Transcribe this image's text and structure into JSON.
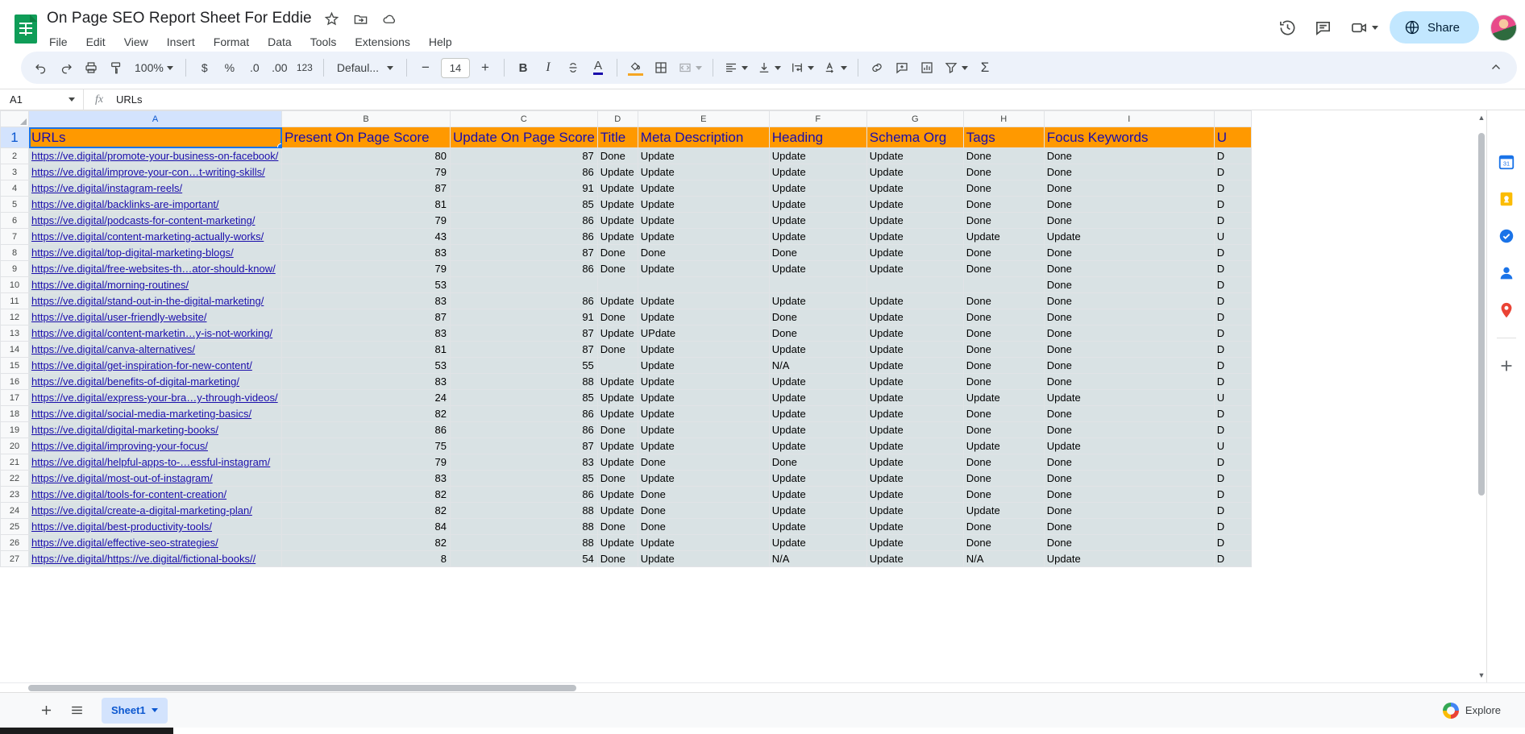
{
  "app": {
    "title": "On Page SEO Report Sheet For Eddie",
    "logo_icon": "google-sheets-icon",
    "star_icon": "star-icon",
    "move_icon": "move-to-folder-icon",
    "cloud_icon": "cloud-saved-icon",
    "menu": [
      "File",
      "Edit",
      "View",
      "Insert",
      "Format",
      "Data",
      "Tools",
      "Extensions",
      "Help"
    ]
  },
  "top_right": {
    "history_icon": "version-history-icon",
    "comment_icon": "comment-icon",
    "meet_icon": "meet-camera-icon",
    "meet_caret": "chevron-down-icon",
    "share_label": "Share",
    "share_icon": "globe-icon",
    "avatar": "user-avatar"
  },
  "toolbar": {
    "undo_icon": "undo-icon",
    "redo_icon": "redo-icon",
    "print_icon": "print-icon",
    "paint_icon": "paint-format-icon",
    "zoom_value": "100%",
    "currency_label": "$",
    "percent_label": "%",
    "decimal_dec_label": ".0",
    "decimal_inc_label": ".00",
    "more_formats_label": "123",
    "font_name": "Defaul...",
    "font_decrease": "−",
    "font_size": "14",
    "font_increase": "+",
    "bold_label": "B",
    "italic_label": "I",
    "strikethrough_icon": "strikethrough-icon",
    "text_color_label": "A",
    "fill_color_icon": "fill-color-icon",
    "borders_icon": "borders-icon",
    "merge_icon": "merge-cells-icon",
    "halign_icon": "horizontal-align-icon",
    "valign_icon": "vertical-align-icon",
    "wrap_icon": "text-wrap-icon",
    "rotate_label": "A",
    "link_icon": "insert-link-icon",
    "comment_icon": "insert-comment-icon",
    "chart_icon": "insert-chart-icon",
    "filter_icon": "filter-icon",
    "functions_label": "Σ",
    "collapse_icon": "chevron-up-icon",
    "text_color_swatch": "#1a0dab",
    "fill_color_swatch": "#f5a623"
  },
  "formula_bar": {
    "name_box": "A1",
    "name_box_caret": "chevron-down-icon",
    "fx_label": "fx",
    "value": "URLs"
  },
  "grid": {
    "column_letters": [
      "A",
      "B",
      "C",
      "D",
      "E",
      "F",
      "G",
      "H",
      "I",
      ""
    ],
    "selected_column": "A",
    "selected_cell": "A1",
    "row_numbers": [
      1,
      2,
      3,
      4,
      5,
      6,
      7,
      8,
      9,
      10,
      11,
      12,
      13,
      14,
      15,
      16,
      17,
      18,
      19,
      20,
      21,
      22,
      23,
      24,
      25,
      26,
      27
    ],
    "header_fill": "#ff9900",
    "header_text_color": "#1a0dab",
    "cell_fill": "#d9e2e4",
    "link_color": "#1a0dab",
    "headers": [
      "URLs",
      "Present On Page Score",
      "Update On Page Score",
      "Title",
      "Meta Description",
      "Heading",
      "Schema Org",
      "Tags",
      "Focus Keywords",
      "U"
    ],
    "rows": [
      {
        "n": 2,
        "url": " https://ve.digital/promote-your-business-on-facebook/",
        "present": "80",
        "update": "87",
        "title": "Done",
        "meta": "Update",
        "heading": "Update",
        "schema": "Update",
        "tags": "Done",
        "focus": "Done",
        "edge": "D"
      },
      {
        "n": 3,
        "url": "https://ve.digital/improve-your-con…t-writing-skills/",
        "present": "79",
        "update": "86",
        "title": "Update",
        "meta": "Update",
        "heading": "Update",
        "schema": "Update",
        "tags": "Done",
        "focus": "Done",
        "edge": "D"
      },
      {
        "n": 4,
        "url": "https://ve.digital/instagram-reels/",
        "present": "87",
        "update": "91",
        "title": "Update",
        "meta": "Update",
        "heading": "Update",
        "schema": "Update",
        "tags": "Done",
        "focus": "Done",
        "edge": "D"
      },
      {
        "n": 5,
        "url": "https://ve.digital/backlinks-are-important/",
        "present": "81",
        "update": "85",
        "title": "Update",
        "meta": "Update",
        "heading": "Update",
        "schema": "Update",
        "tags": "Done",
        "focus": "Done",
        "edge": "D"
      },
      {
        "n": 6,
        "url": "https://ve.digital/podcasts-for-content-marketing/",
        "present": "79",
        "update": "86",
        "title": "Update",
        "meta": "Update",
        "heading": "Update",
        "schema": "Update",
        "tags": "Done",
        "focus": "Done",
        "edge": "D"
      },
      {
        "n": 7,
        "url": "https://ve.digital/content-marketing-actually-works/",
        "present": "43",
        "update": "86",
        "title": "Update",
        "meta": "Update",
        "heading": "Update",
        "schema": "Update",
        "tags": "Update",
        "focus": "Update",
        "edge": "U"
      },
      {
        "n": 8,
        "url": "https://ve.digital/top-digital-marketing-blogs/",
        "present": "83",
        "update": "87",
        "title": "Done",
        "meta": "Done",
        "heading": "Done",
        "schema": "Update",
        "tags": "Done",
        "focus": "Done",
        "edge": "D"
      },
      {
        "n": 9,
        "url": "https://ve.digital/free-websites-th…ator-should-know/",
        "present": "79",
        "update": "86",
        "title": "Done",
        "meta": "Update",
        "heading": "Update",
        "schema": "Update",
        "tags": "Done",
        "focus": "Done",
        "edge": "D"
      },
      {
        "n": 10,
        "url": "https://ve.digital/morning-routines/",
        "present": "53",
        "update": "",
        "title": "",
        "meta": "",
        "heading": "",
        "schema": "",
        "tags": "",
        "focus": "Done",
        "edge": "D"
      },
      {
        "n": 11,
        "url": "https://ve.digital/stand-out-in-the-digital-marketing/ ",
        "present": "83",
        "update": "86",
        "title": "Update",
        "meta": "Update",
        "heading": "Update",
        "schema": "Update",
        "tags": "Done",
        "focus": "Done",
        "edge": "D"
      },
      {
        "n": 12,
        "url": "https://ve.digital/user-friendly-website/",
        "present": "87",
        "update": "91",
        "title": "Done",
        "meta": "Update",
        "heading": "Done",
        "schema": "Update",
        "tags": "Done",
        "focus": "Done",
        "edge": "D"
      },
      {
        "n": 13,
        "url": "https://ve.digital/content-marketin…y-is-not-working/",
        "present": "83",
        "update": "87",
        "title": "Update",
        "meta": "UPdate",
        "heading": "Done",
        "schema": "Update",
        "tags": "Done",
        "focus": "Done",
        "edge": "D"
      },
      {
        "n": 14,
        "url": "https://ve.digital/canva-alternatives/",
        "present": "81",
        "update": "87",
        "title": "Done",
        "meta": "Update",
        "heading": "Update",
        "schema": "Update",
        "tags": "Done",
        "focus": "Done",
        "edge": "D"
      },
      {
        "n": 15,
        "url": "https://ve.digital/get-inspiration-for-new-content/",
        "present": "53",
        "update": "55",
        "title": "",
        "meta": "Update",
        "heading": "N/A",
        "schema": "Update",
        "tags": "Done",
        "focus": "Done",
        "edge": "D"
      },
      {
        "n": 16,
        "url": "https://ve.digital/benefits-of-digital-marketing/",
        "present": "83",
        "update": "88",
        "title": "Update",
        "meta": "Update",
        "heading": "Update",
        "schema": "Update",
        "tags": "Done",
        "focus": "Done",
        "edge": "D"
      },
      {
        "n": 17,
        "url": "https://ve.digital/express-your-bra…y-through-videos/",
        "present": "24",
        "update": "85",
        "title": "Update",
        "meta": "Update",
        "heading": "Update",
        "schema": "Update",
        "tags": "Update",
        "focus": "Update",
        "edge": "U"
      },
      {
        "n": 18,
        "url": "https://ve.digital/social-media-marketing-basics/",
        "present": "82",
        "update": "86",
        "title": "Update",
        "meta": "Update",
        "heading": "Update",
        "schema": "Update",
        "tags": "Done",
        "focus": "Done",
        "edge": "D"
      },
      {
        "n": 19,
        "url": "https://ve.digital/digital-marketing-books/",
        "present": "86",
        "update": "86",
        "title": "Done",
        "meta": "Update",
        "heading": "Update",
        "schema": "Update",
        "tags": "Done",
        "focus": "Done",
        "edge": "D"
      },
      {
        "n": 20,
        "url": "https://ve.digital/improving-your-focus/",
        "present": "75",
        "update": "87",
        "title": "Update",
        "meta": "Update",
        "heading": "Update",
        "schema": "Update",
        "tags": "Update",
        "focus": "Update",
        "edge": "U"
      },
      {
        "n": 21,
        "url": "https://ve.digital/helpful-apps-to-…essful-instagram/",
        "present": "79",
        "update": "83",
        "title": "Update",
        "meta": "Done",
        "heading": "Done",
        "schema": "Update",
        "tags": "Done",
        "focus": "Done",
        "edge": "D"
      },
      {
        "n": 22,
        "url": "https://ve.digital/most-out-of-instagram/",
        "present": "83",
        "update": "85",
        "title": "Done",
        "meta": "Update",
        "heading": "Update",
        "schema": "Update",
        "tags": "Done",
        "focus": "Done",
        "edge": "D"
      },
      {
        "n": 23,
        "url": "https://ve.digital/tools-for-content-creation/",
        "present": "82",
        "update": "86",
        "title": "Update",
        "meta": "Done",
        "heading": "Update",
        "schema": "Update",
        "tags": "Done",
        "focus": "Done",
        "edge": "D"
      },
      {
        "n": 24,
        "url": "https://ve.digital/create-a-digital-marketing-plan/",
        "present": "82",
        "update": "88",
        "title": "Update",
        "meta": "Done",
        "heading": "Update",
        "schema": "Update",
        "tags": "Update",
        "focus": "Done",
        "edge": "D"
      },
      {
        "n": 25,
        "url": "https://ve.digital/best-productivity-tools/",
        "present": "84",
        "update": "88",
        "title": "Done",
        "meta": "Done",
        "heading": "Update",
        "schema": "Update",
        "tags": "Done",
        "focus": "Done",
        "edge": "D"
      },
      {
        "n": 26,
        "url": "https://ve.digital/effective-seo-strategies/",
        "present": "82",
        "update": "88",
        "title": "Update",
        "meta": "Update",
        "heading": "Update",
        "schema": "Update",
        "tags": "Done",
        "focus": "Done",
        "edge": "D"
      },
      {
        "n": 27,
        "url": "https://ve.digital/https://ve.digital/fictional-books//",
        "present": "8",
        "update": "54",
        "title": "Done",
        "meta": "Update",
        "heading": "N/A",
        "schema": "Update",
        "tags": "N/A",
        "focus": "Update",
        "edge": "D"
      }
    ]
  },
  "side_panel": {
    "icons": [
      "calendar-icon",
      "keep-icon",
      "tasks-icon",
      "contacts-icon",
      "maps-icon",
      "add-addon-icon"
    ]
  },
  "bottom": {
    "add_sheet_icon": "add-sheet-icon",
    "all_sheets_icon": "all-sheets-icon",
    "sheet_tab_label": "Sheet1",
    "sheet_tab_caret": "chevron-down-icon",
    "explore_label": "Explore",
    "explore_icon": "explore-icon"
  }
}
